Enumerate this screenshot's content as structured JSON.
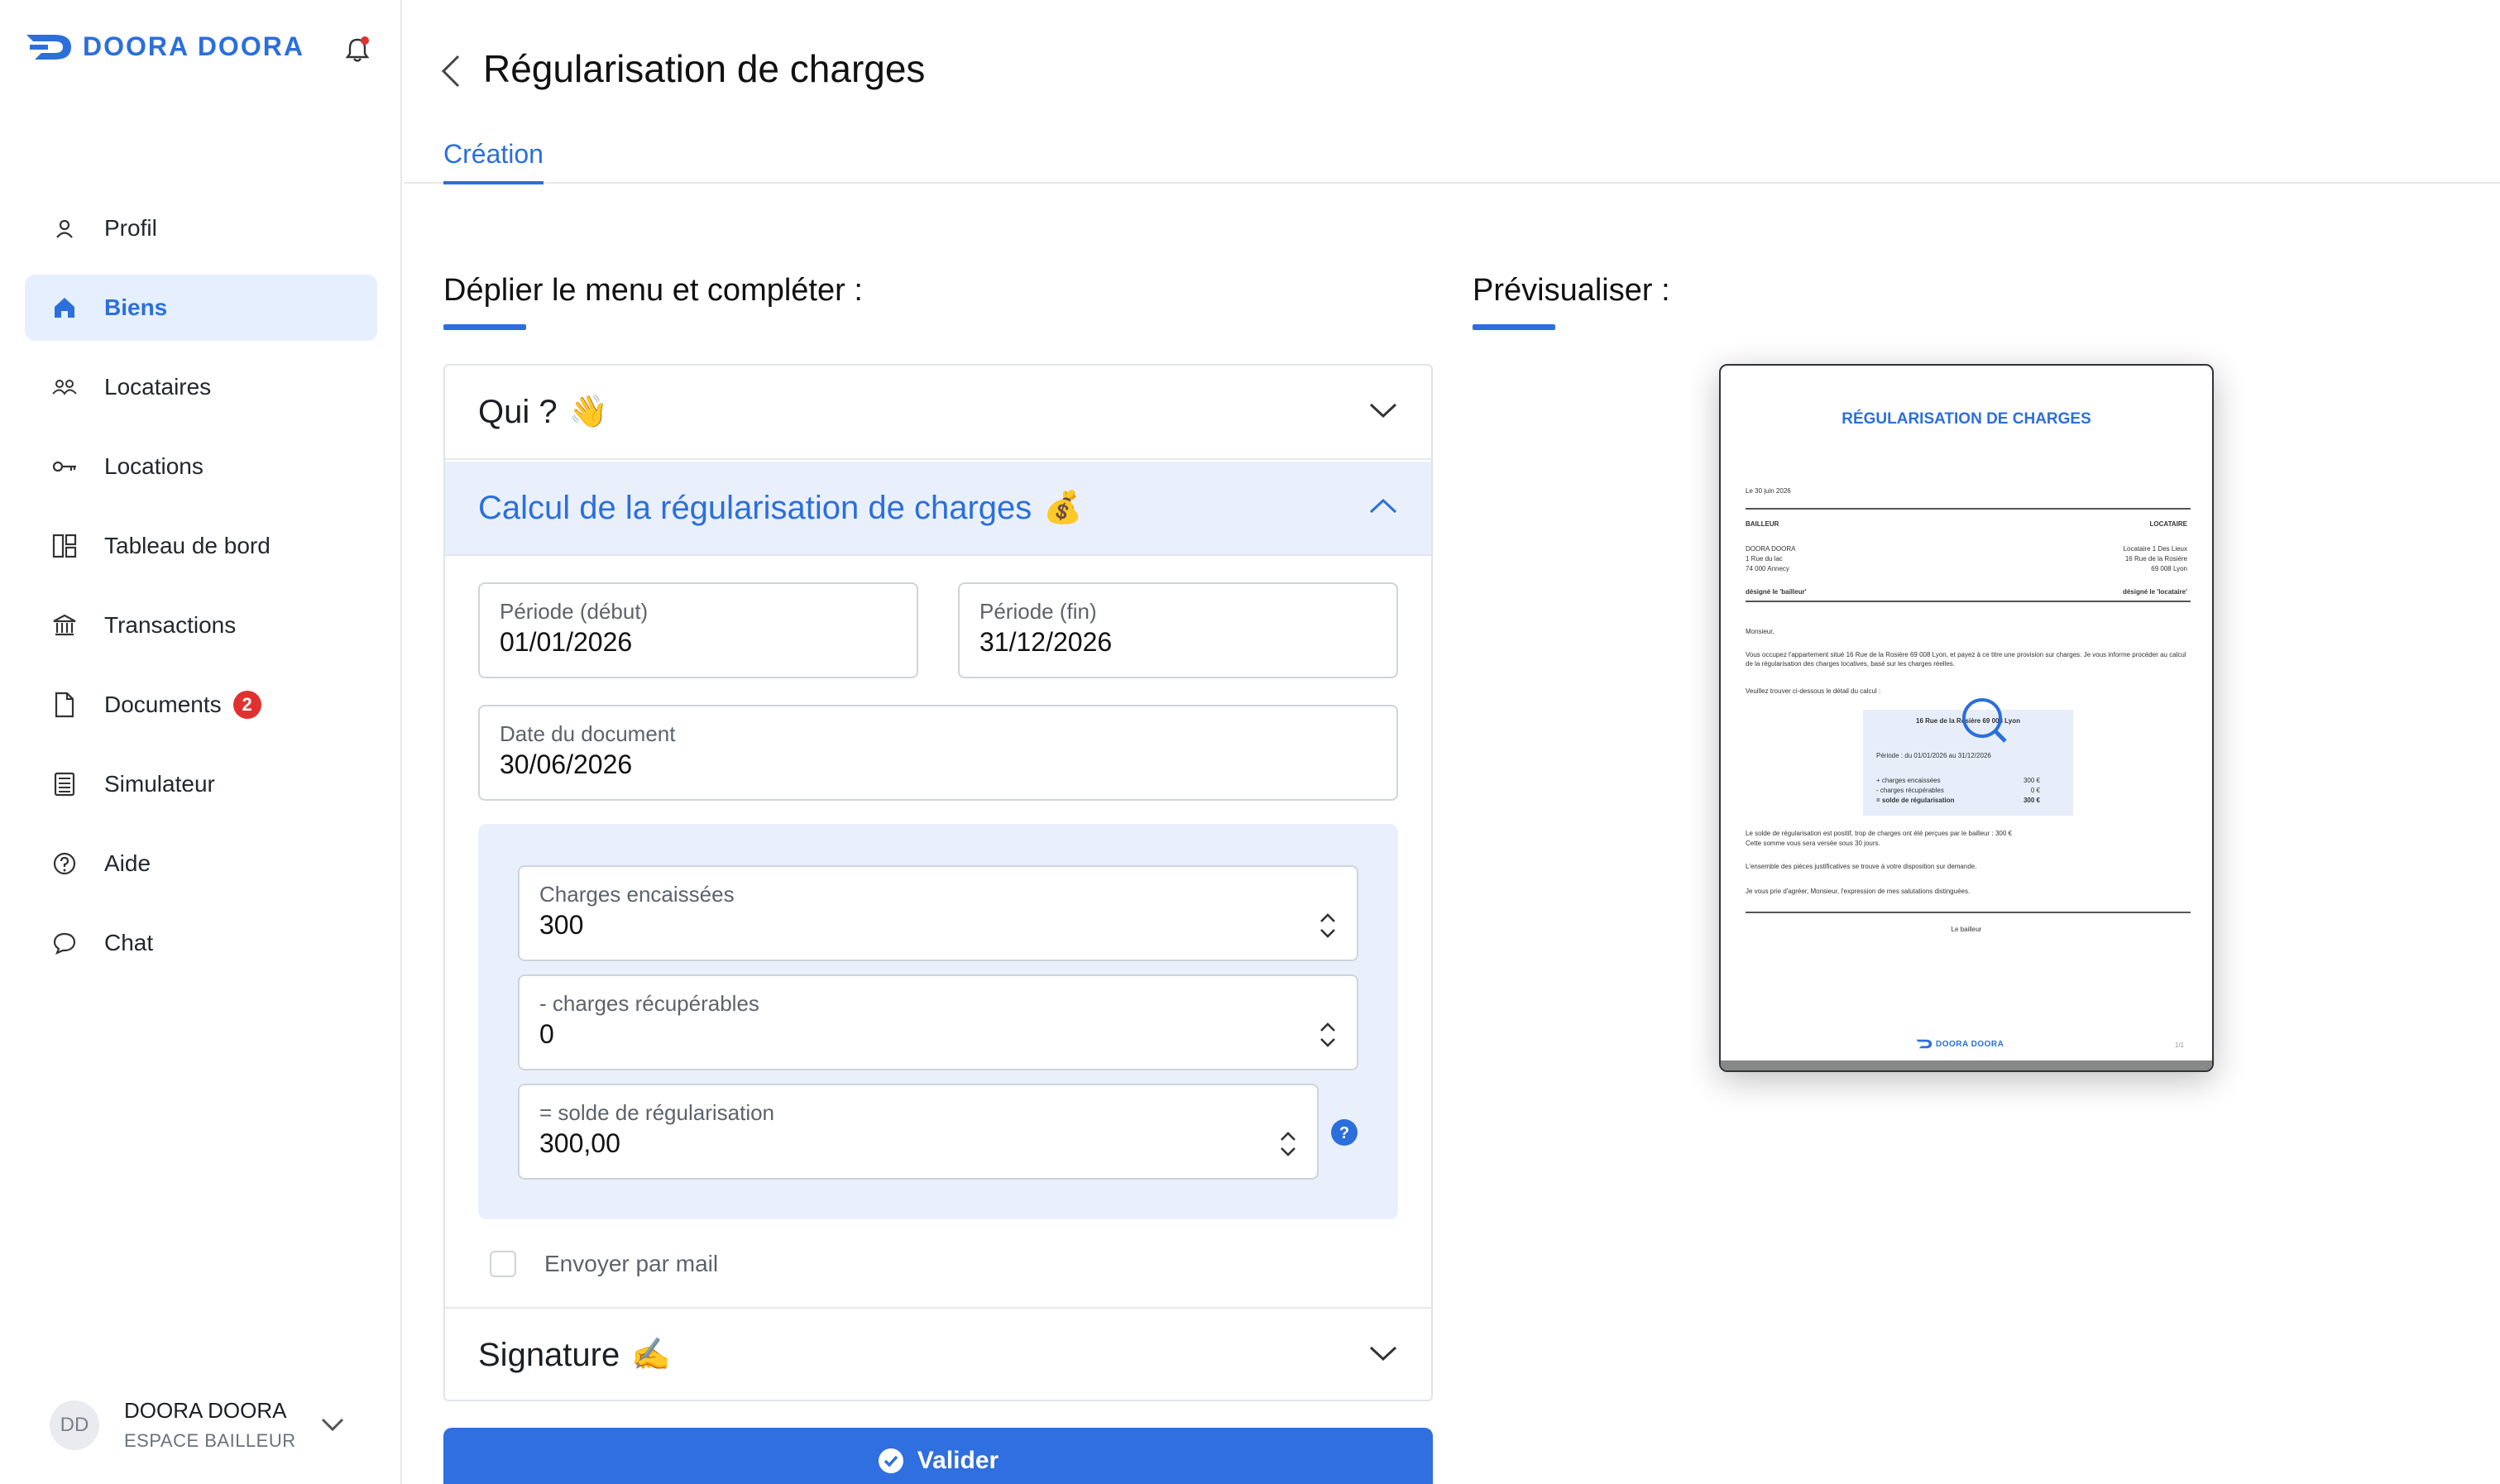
{
  "brand": {
    "name": "DOORA DOORA",
    "color": "#2b6fdc"
  },
  "sidebar": {
    "items": [
      {
        "label": "Profil",
        "icon": "user-icon"
      },
      {
        "label": "Biens",
        "icon": "home-icon",
        "active": true
      },
      {
        "label": "Locataires",
        "icon": "users-icon"
      },
      {
        "label": "Locations",
        "icon": "key-icon"
      },
      {
        "label": "Tableau de bord",
        "icon": "dashboard-icon"
      },
      {
        "label": "Transactions",
        "icon": "bank-icon"
      },
      {
        "label": "Documents",
        "icon": "document-icon",
        "badge": "2"
      },
      {
        "label": "Simulateur",
        "icon": "calculator-icon"
      },
      {
        "label": "Aide",
        "icon": "help-icon"
      },
      {
        "label": "Chat",
        "icon": "chat-icon"
      }
    ],
    "user": {
      "initials": "DD",
      "name": "DOORA DOORA",
      "role": "ESPACE BAILLEUR"
    }
  },
  "header": {
    "title": "Régularisation de charges",
    "tab": "Création"
  },
  "form": {
    "section_title": "Déplier le menu et compléter :",
    "accordions": {
      "qui": {
        "label": "Qui ?",
        "emoji": "👋"
      },
      "calcul": {
        "label": "Calcul de la régularisation de charges",
        "emoji": "💰"
      },
      "signature": {
        "label": "Signature",
        "emoji": "✍️"
      }
    },
    "periode_debut": {
      "label": "Période (début)",
      "value": "01/01/2026"
    },
    "periode_fin": {
      "label": "Période (fin)",
      "value": "31/12/2026"
    },
    "date_document": {
      "label": "Date du document",
      "value": "30/06/2026"
    },
    "charges_encaissees": {
      "label": "Charges encaissées",
      "value": "300"
    },
    "charges_recuperables": {
      "label": "- charges récupérables",
      "value": "0"
    },
    "solde": {
      "label": "= solde de régularisation",
      "value": "300,00"
    },
    "mail_label": "Envoyer par mail",
    "submit_label": "Valider"
  },
  "preview": {
    "section_title": "Prévisualiser :",
    "doc": {
      "title": "RÉGULARISATION DE CHARGES",
      "date_line": "Le 30 juin 2026",
      "bailleur_head": "BAILLEUR",
      "locataire_head": "LOCATAIRE",
      "bailleur_lines": [
        "DOORA DOORA",
        "1 Rue du lac",
        "74 000 Annecy"
      ],
      "locataire_lines": [
        "Locataire 1 Des Lieux",
        "16 Rue de la Rosière",
        "69 008 Lyon"
      ],
      "bailleur_desig": "désigné le 'bailleur'",
      "locataire_desig": "désigné le 'locataire'",
      "greeting": "Monsieur,",
      "intro": "Vous occupez l'appartement situé 16 Rue de la Rosière 69 008 Lyon, et payez à ce titre une provision sur charges. Je vous informe procéder au calcul de la régularisation des charges locatives, basé sur les charges réelles.",
      "detail_line": "Veuillez trouver ci-dessous le détail du calcul :",
      "calc_address": "16 Rue de la Rosière 69 008 Lyon",
      "calc_period": "Période : du 01/01/2026 au 31/12/2026",
      "calc_rows": [
        {
          "label": "+ charges encaissées",
          "value": "300 €"
        },
        {
          "label": "- charges récupérables",
          "value": "0 €"
        },
        {
          "label": "= solde de régularisation",
          "value": "300 €"
        }
      ],
      "solde_text": "Le solde de régularisation est positif, trop de charges ont été perçues par le bailleur : 300 €",
      "solde_text2": "Cette somme vous sera versée sous 30 jours.",
      "pieces_text": "L'ensemble des pièces justificatives se trouve à votre disposition sur demande.",
      "closing": "Je vous prie d'agréer, Monsieur, l'expression de mes salutations distinguées.",
      "signature": "Le bailleur",
      "footer_brand": "DOORA DOORA",
      "page_num": "1/1"
    }
  }
}
